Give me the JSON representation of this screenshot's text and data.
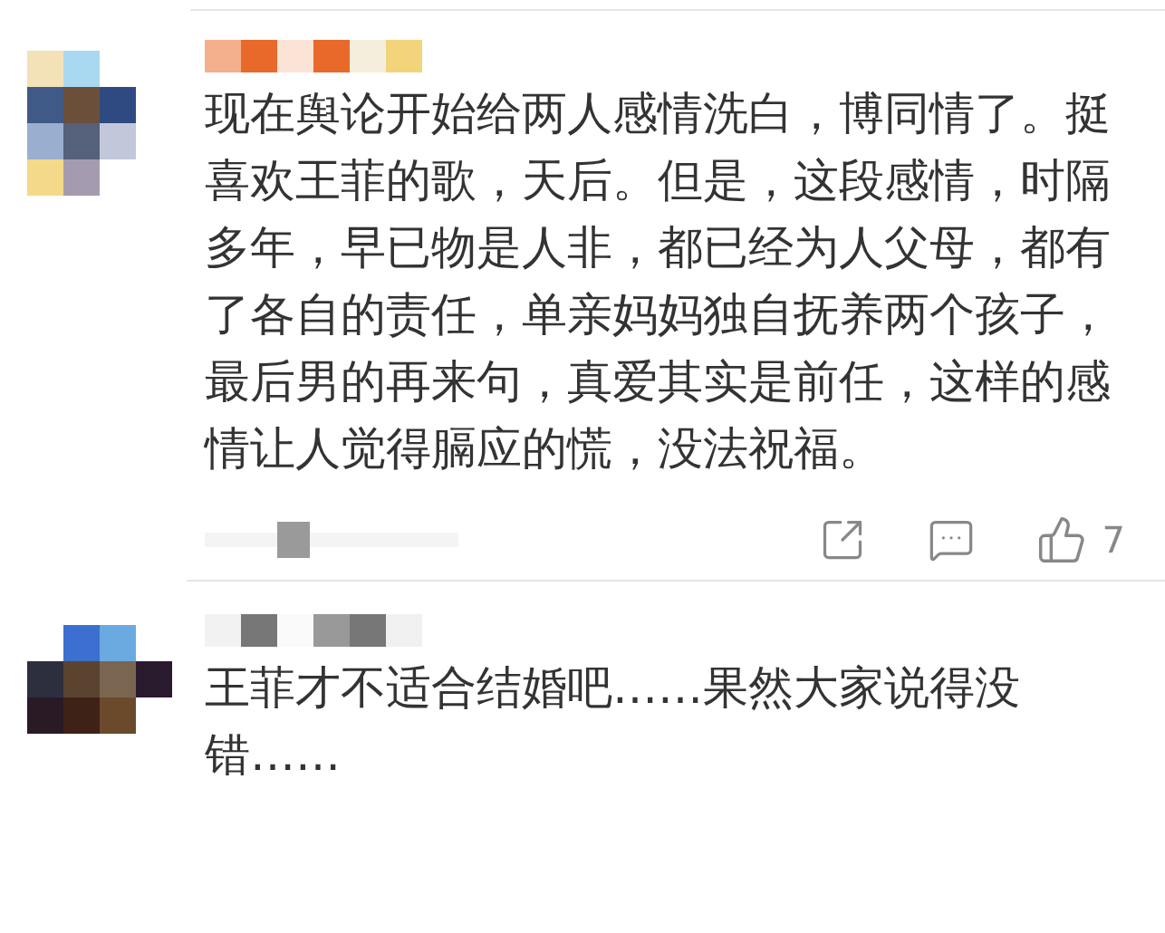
{
  "comments": [
    {
      "text": "现在舆论开始给两人感情洗白，博同情了。挺喜欢王菲的歌，天后。但是，这段感情，时隔多年，早已物是人非，都已经为人父母，都有了各自的责任，单亲妈妈独自抚养两个孩子，最后男的再来句，真爱其实是前任，这样的感情让人觉得膈应的慌，没法祝福。",
      "likes": "7"
    },
    {
      "text": "王菲才不适合结婚吧……果然大家说得没错……"
    }
  ]
}
